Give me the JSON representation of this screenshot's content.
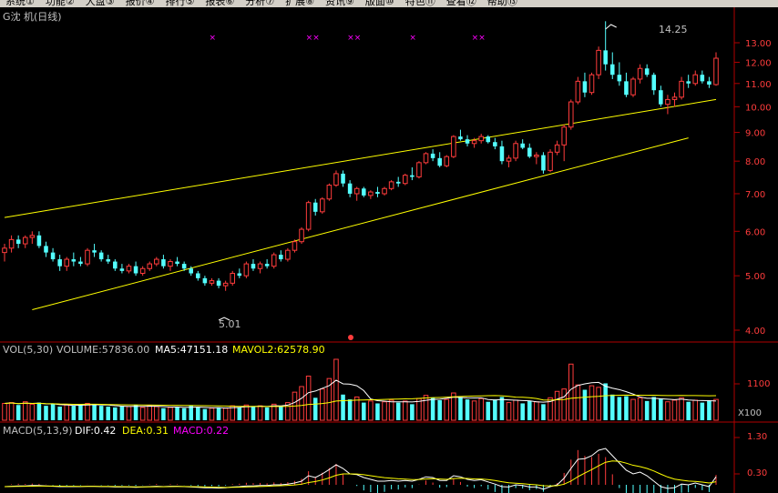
{
  "menu": [
    "系统①",
    "功能②",
    "大盘③",
    "报价④",
    "排行⑤",
    "报表⑥",
    "分析⑦",
    "扩展⑧",
    "资讯⑨",
    "版面⑩",
    "特色⑪",
    "查看⑫",
    "帮助⑬"
  ],
  "price_panel": {
    "title": "G沈 机(日线)",
    "high_annotation": "14.25",
    "low_annotation": "5.01",
    "y_ticks": [
      "13.00",
      "12.00",
      "11.00",
      "10.00",
      "9.00",
      "8.00",
      "7.00",
      "6.00",
      "5.00",
      "4.00"
    ],
    "y_tick_values": [
      13,
      12,
      11,
      10,
      9,
      8,
      7,
      6,
      5,
      4
    ],
    "marker_count": 10
  },
  "volume_panel": {
    "label": "VOL(5,30)",
    "volume": "VOLUME:57836.00",
    "ma5": "MA5:47151.18",
    "mavol2": "MAVOL2:62578.90",
    "y_ticks": [
      "1100",
      ""
    ],
    "unit": "X100"
  },
  "macd_panel": {
    "label": "MACD(5,13,9)",
    "dif": "DIF:0.42",
    "dea": "DEA:0.31",
    "macd": "MACD:0.22",
    "y_ticks": [
      "1.30",
      "0.30"
    ]
  },
  "colors": {
    "up": "#ff3c3c",
    "down": "#54ffff",
    "channel": "#ffff00",
    "axis": "#b00000",
    "text": "#c0c0c0",
    "ma_white": "#ffffff",
    "ma_yellow": "#ffff00",
    "macd_purple": "#ff00ff"
  },
  "chart_data": {
    "type": "candlestick",
    "ohlc": [
      [
        5.5,
        5.7,
        5.3,
        5.6
      ],
      [
        5.6,
        5.9,
        5.5,
        5.8
      ],
      [
        5.8,
        5.9,
        5.6,
        5.7
      ],
      [
        5.7,
        5.9,
        5.6,
        5.85
      ],
      [
        5.85,
        6.0,
        5.7,
        5.9
      ],
      [
        5.9,
        6.0,
        5.6,
        5.65
      ],
      [
        5.65,
        5.75,
        5.4,
        5.5
      ],
      [
        5.5,
        5.6,
        5.3,
        5.35
      ],
      [
        5.35,
        5.45,
        5.1,
        5.2
      ],
      [
        5.2,
        5.4,
        5.1,
        5.35
      ],
      [
        5.35,
        5.5,
        5.2,
        5.3
      ],
      [
        5.3,
        5.4,
        5.2,
        5.25
      ],
      [
        5.25,
        5.6,
        5.2,
        5.55
      ],
      [
        5.55,
        5.7,
        5.4,
        5.5
      ],
      [
        5.5,
        5.55,
        5.3,
        5.35
      ],
      [
        5.35,
        5.45,
        5.25,
        5.3
      ],
      [
        5.3,
        5.35,
        5.1,
        5.15
      ],
      [
        5.15,
        5.25,
        5.05,
        5.1
      ],
      [
        5.1,
        5.25,
        5.05,
        5.2
      ],
      [
        5.2,
        5.3,
        5.0,
        5.05
      ],
      [
        5.05,
        5.2,
        5.0,
        5.15
      ],
      [
        5.15,
        5.3,
        5.1,
        5.25
      ],
      [
        5.25,
        5.4,
        5.2,
        5.35
      ],
      [
        5.35,
        5.45,
        5.15,
        5.2
      ],
      [
        5.2,
        5.35,
        5.1,
        5.3
      ],
      [
        5.3,
        5.4,
        5.2,
        5.25
      ],
      [
        5.25,
        5.3,
        5.1,
        5.15
      ],
      [
        5.15,
        5.2,
        5.0,
        5.05
      ],
      [
        5.05,
        5.1,
        4.9,
        4.95
      ],
      [
        4.95,
        5.0,
        4.8,
        4.85
      ],
      [
        4.85,
        4.95,
        4.8,
        4.9
      ],
      [
        4.9,
        4.95,
        4.75,
        4.8
      ],
      [
        4.8,
        4.9,
        4.7,
        4.85
      ],
      [
        4.85,
        5.1,
        4.8,
        5.05
      ],
      [
        5.05,
        5.15,
        4.95,
        5.0
      ],
      [
        5.0,
        5.3,
        4.95,
        5.25
      ],
      [
        5.25,
        5.35,
        5.1,
        5.15
      ],
      [
        5.15,
        5.3,
        5.05,
        5.25
      ],
      [
        5.25,
        5.35,
        5.15,
        5.2
      ],
      [
        5.2,
        5.5,
        5.15,
        5.45
      ],
      [
        5.45,
        5.55,
        5.3,
        5.35
      ],
      [
        5.35,
        5.6,
        5.3,
        5.55
      ],
      [
        5.55,
        5.8,
        5.5,
        5.75
      ],
      [
        5.75,
        6.1,
        5.7,
        6.05
      ],
      [
        6.05,
        6.8,
        6.0,
        6.75
      ],
      [
        6.75,
        6.85,
        6.4,
        6.5
      ],
      [
        6.5,
        6.9,
        6.45,
        6.85
      ],
      [
        6.85,
        7.3,
        6.8,
        7.25
      ],
      [
        7.25,
        7.7,
        7.2,
        7.6
      ],
      [
        7.6,
        7.7,
        7.2,
        7.3
      ],
      [
        7.3,
        7.4,
        6.9,
        7.0
      ],
      [
        7.0,
        7.2,
        6.8,
        7.15
      ],
      [
        7.15,
        7.2,
        6.9,
        6.95
      ],
      [
        6.95,
        7.1,
        6.85,
        7.05
      ],
      [
        7.05,
        7.2,
        6.9,
        7.0
      ],
      [
        7.0,
        7.2,
        6.95,
        7.15
      ],
      [
        7.15,
        7.4,
        7.1,
        7.35
      ],
      [
        7.35,
        7.5,
        7.2,
        7.3
      ],
      [
        7.3,
        7.6,
        7.25,
        7.55
      ],
      [
        7.55,
        7.8,
        7.4,
        7.5
      ],
      [
        7.5,
        8.0,
        7.45,
        7.95
      ],
      [
        7.95,
        8.3,
        7.9,
        8.25
      ],
      [
        8.25,
        8.4,
        8.0,
        8.1
      ],
      [
        8.1,
        8.3,
        7.8,
        7.85
      ],
      [
        7.85,
        8.2,
        7.8,
        8.15
      ],
      [
        8.15,
        8.9,
        8.1,
        8.85
      ],
      [
        8.85,
        9.1,
        8.7,
        8.75
      ],
      [
        8.75,
        8.9,
        8.5,
        8.6
      ],
      [
        8.6,
        8.8,
        8.45,
        8.7
      ],
      [
        8.7,
        8.95,
        8.6,
        8.85
      ],
      [
        8.85,
        8.9,
        8.6,
        8.65
      ],
      [
        8.65,
        8.8,
        8.4,
        8.5
      ],
      [
        8.5,
        8.7,
        7.9,
        8.0
      ],
      [
        8.0,
        8.2,
        7.8,
        8.1
      ],
      [
        8.1,
        8.7,
        8.0,
        8.6
      ],
      [
        8.6,
        8.75,
        8.4,
        8.45
      ],
      [
        8.45,
        8.6,
        8.1,
        8.15
      ],
      [
        8.15,
        8.3,
        7.9,
        8.2
      ],
      [
        8.2,
        8.3,
        7.6,
        7.7
      ],
      [
        7.7,
        8.4,
        7.65,
        8.3
      ],
      [
        8.3,
        8.7,
        8.2,
        8.55
      ],
      [
        8.55,
        9.3,
        8.0,
        9.2
      ],
      [
        9.2,
        10.3,
        9.1,
        10.2
      ],
      [
        10.2,
        11.3,
        10.1,
        11.1
      ],
      [
        11.1,
        11.5,
        10.4,
        10.6
      ],
      [
        10.6,
        11.5,
        10.5,
        11.4
      ],
      [
        11.4,
        12.8,
        11.2,
        12.6
      ],
      [
        12.6,
        14.2,
        11.6,
        11.9
      ],
      [
        11.9,
        12.5,
        11.2,
        11.4
      ],
      [
        11.4,
        12.0,
        10.9,
        11.1
      ],
      [
        11.1,
        11.5,
        10.4,
        10.5
      ],
      [
        10.5,
        11.3,
        10.4,
        11.2
      ],
      [
        11.2,
        11.9,
        11.0,
        11.7
      ],
      [
        11.7,
        11.9,
        11.3,
        11.4
      ],
      [
        11.4,
        11.5,
        10.5,
        10.7
      ],
      [
        10.7,
        10.9,
        10.0,
        10.1
      ],
      [
        10.1,
        10.5,
        9.7,
        10.3
      ],
      [
        10.3,
        10.6,
        10.0,
        10.4
      ],
      [
        10.4,
        11.3,
        10.3,
        11.1
      ],
      [
        11.1,
        11.4,
        10.8,
        11.0
      ],
      [
        11.0,
        11.6,
        10.9,
        11.4
      ],
      [
        11.4,
        11.6,
        11.0,
        11.1
      ],
      [
        11.1,
        11.3,
        10.8,
        10.95
      ],
      [
        10.95,
        12.5,
        10.9,
        12.2
      ]
    ],
    "channel_upper": [
      [
        0,
        6.35
      ],
      [
        103,
        10.3
      ]
    ],
    "channel_lower": [
      [
        4,
        4.35
      ],
      [
        99,
        8.8
      ]
    ],
    "volume": [
      2.1,
      2.2,
      1.9,
      2.3,
      2.0,
      2.2,
      1.8,
      2.0,
      1.7,
      1.9,
      1.8,
      2.0,
      2.1,
      1.9,
      1.8,
      1.7,
      1.6,
      1.8,
      1.7,
      1.9,
      1.6,
      1.8,
      1.7,
      1.5,
      1.6,
      1.7,
      1.5,
      1.8,
      1.6,
      1.4,
      1.5,
      1.6,
      1.5,
      1.8,
      1.6,
      1.9,
      1.7,
      1.8,
      1.6,
      2.0,
      1.8,
      2.2,
      3.5,
      4.2,
      5.5,
      2.8,
      3.9,
      5.2,
      7.6,
      3.2,
      2.6,
      2.9,
      2.2,
      2.4,
      2.1,
      2.3,
      2.5,
      2.2,
      2.4,
      2.0,
      2.7,
      3.1,
      2.8,
      2.5,
      2.6,
      3.4,
      2.9,
      2.6,
      2.4,
      2.7,
      2.3,
      2.6,
      2.9,
      2.2,
      2.5,
      2.1,
      2.4,
      2.3,
      2.0,
      2.8,
      3.6,
      3.9,
      7.0,
      4.4,
      3.8,
      4.3,
      4.1,
      4.6,
      3.2,
      2.9,
      3.0,
      2.6,
      2.8,
      2.4,
      2.9,
      2.7,
      2.3,
      2.5,
      2.8,
      2.3,
      2.5,
      2.2,
      2.4,
      2.6
    ],
    "volume_ticks": [
      1100,
      0
    ],
    "macd": [
      -0.05,
      -0.04,
      -0.03,
      -0.03,
      -0.02,
      -0.02,
      -0.03,
      -0.04,
      -0.05,
      -0.05,
      -0.05,
      -0.05,
      -0.04,
      -0.04,
      -0.05,
      -0.05,
      -0.06,
      -0.06,
      -0.06,
      -0.07,
      -0.06,
      -0.05,
      -0.04,
      -0.05,
      -0.04,
      -0.04,
      -0.05,
      -0.06,
      -0.07,
      -0.08,
      -0.08,
      -0.09,
      -0.08,
      -0.06,
      -0.05,
      -0.03,
      -0.03,
      -0.02,
      -0.02,
      0.0,
      0.0,
      0.02,
      0.05,
      0.1,
      0.25,
      0.2,
      0.3,
      0.42,
      0.55,
      0.45,
      0.3,
      0.28,
      0.2,
      0.15,
      0.1,
      0.1,
      0.12,
      0.1,
      0.12,
      0.1,
      0.15,
      0.22,
      0.2,
      0.12,
      0.12,
      0.25,
      0.22,
      0.15,
      0.12,
      0.14,
      0.08,
      0.02,
      -0.05,
      -0.06,
      0.0,
      -0.02,
      -0.06,
      -0.06,
      -0.12,
      -0.05,
      0.0,
      0.18,
      0.45,
      0.7,
      0.72,
      0.8,
      0.95,
      1.0,
      0.8,
      0.6,
      0.4,
      0.3,
      0.35,
      0.25,
      0.1,
      -0.05,
      -0.1,
      -0.08,
      0.02,
      0.0,
      0.05,
      0.0,
      -0.05,
      0.22
    ],
    "macd_ticks": [
      1.3,
      0.3
    ]
  }
}
